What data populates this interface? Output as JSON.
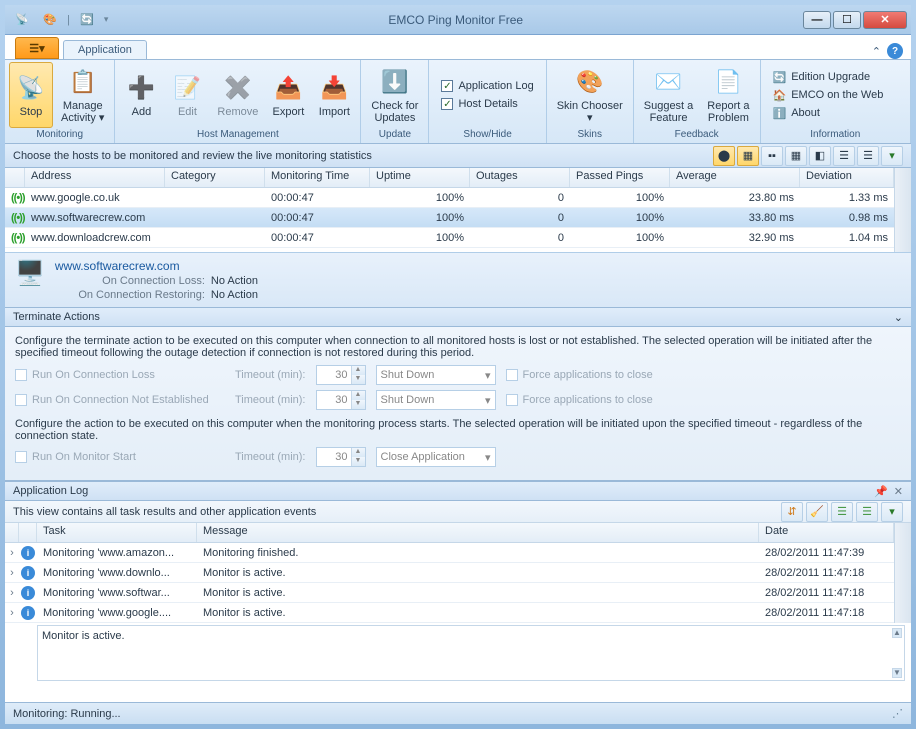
{
  "title": "EMCO Ping Monitor Free",
  "tabs": {
    "active": "Application"
  },
  "ribbon": {
    "monitoring": {
      "label": "Monitoring",
      "stop": "Stop",
      "manage": "Manage\nActivity"
    },
    "hostmgmt": {
      "label": "Host Management",
      "add": "Add",
      "edit": "Edit",
      "remove": "Remove",
      "export": "Export",
      "import": "Import"
    },
    "update": {
      "label": "Update",
      "check": "Check for\nUpdates"
    },
    "showhide": {
      "label": "Show/Hide",
      "applog": "Application Log",
      "hostdetails": "Host Details"
    },
    "skins": {
      "label": "Skins",
      "chooser": "Skin Chooser"
    },
    "feedback": {
      "label": "Feedback",
      "suggest": "Suggest a\nFeature",
      "report": "Report a\nProblem"
    },
    "information": {
      "label": "Information",
      "upgrade": "Edition Upgrade",
      "web": "EMCO on the Web",
      "about": "About"
    }
  },
  "desc": "Choose the hosts to be monitored and review the live monitoring statistics",
  "grid": {
    "headers": {
      "address": "Address",
      "category": "Category",
      "montime": "Monitoring Time",
      "uptime": "Uptime",
      "outages": "Outages",
      "passed": "Passed Pings",
      "average": "Average",
      "deviation": "Deviation"
    },
    "rows": [
      {
        "address": "www.google.co.uk",
        "category": "",
        "montime": "00:00:47",
        "uptime": "100%",
        "outages": "0",
        "passed": "100%",
        "average": "23.80 ms",
        "deviation": "1.33 ms"
      },
      {
        "address": "www.softwarecrew.com",
        "category": "",
        "montime": "00:00:47",
        "uptime": "100%",
        "outages": "0",
        "passed": "100%",
        "average": "33.80 ms",
        "deviation": "0.98 ms"
      },
      {
        "address": "www.downloadcrew.com",
        "category": "",
        "montime": "00:00:47",
        "uptime": "100%",
        "outages": "0",
        "passed": "100%",
        "average": "32.90 ms",
        "deviation": "1.04 ms"
      }
    ]
  },
  "detail": {
    "host": "www.softwarecrew.com",
    "onloss_label": "On Connection Loss:",
    "onloss_val": "No Action",
    "onrest_label": "On Connection Restoring:",
    "onrest_val": "No Action"
  },
  "terminate": {
    "title": "Terminate Actions",
    "desc1": "Configure the terminate action to be executed on this computer when connection to all monitored hosts is lost or not established. The selected operation will be initiated after the specified timeout following the outage detection if connection is not restored during this period.",
    "run_loss": "Run On Connection Loss",
    "run_notest": "Run On Connection Not Established",
    "timeout_label": "Timeout (min):",
    "timeout_val": "30",
    "action_val": "Shut Down",
    "force": "Force applications to close",
    "desc2": "Configure the action to be executed on this computer when the monitoring process starts. The selected operation will be initiated upon the specified timeout - regardless of the connection state.",
    "run_monstart": "Run On Monitor Start",
    "close_app": "Close Application"
  },
  "log": {
    "title": "Application Log",
    "desc": "This view contains all task results and other application events",
    "headers": {
      "task": "Task",
      "message": "Message",
      "date": "Date"
    },
    "rows": [
      {
        "task": "Monitoring 'www.amazon...",
        "message": "Monitoring finished.",
        "date": "28/02/2011 11:47:39"
      },
      {
        "task": "Monitoring 'www.downlo...",
        "message": "Monitor is active.",
        "date": "28/02/2011 11:47:18"
      },
      {
        "task": "Monitoring 'www.softwar...",
        "message": "Monitor is active.",
        "date": "28/02/2011 11:47:18"
      },
      {
        "task": "Monitoring 'www.google....",
        "message": "Monitor is active.",
        "date": "28/02/2011 11:47:18"
      }
    ],
    "detail": "Monitor is active."
  },
  "status": "Monitoring: Running..."
}
